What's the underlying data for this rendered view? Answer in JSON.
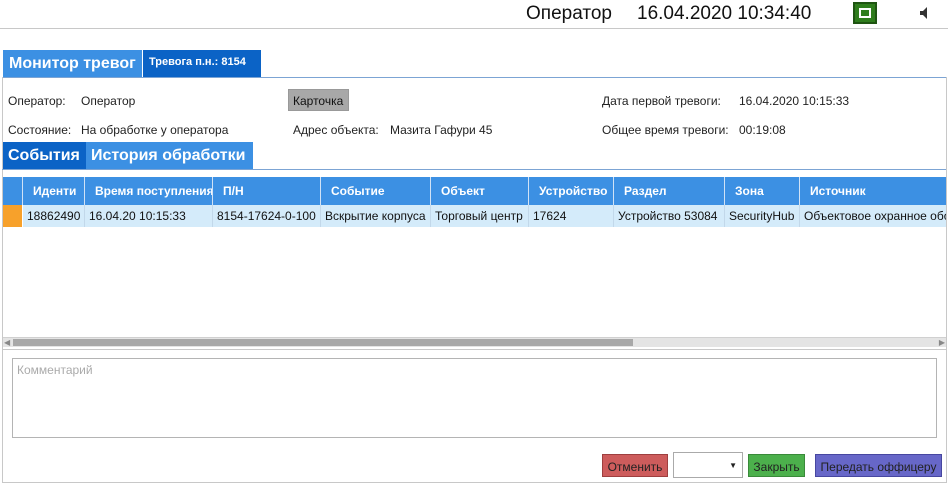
{
  "topbar": {
    "operator_name": "Оператор",
    "datetime": "16.04.2020 10:34:40",
    "network_icon": "network-connected-icon",
    "sound_icon": "speaker-icon",
    "network_color": "#2f7d1d"
  },
  "tabs": {
    "monitor": "Монитор тревог",
    "alarm": "Тревога п.н.: 8154"
  },
  "info": {
    "operator_label": "Оператор:",
    "operator_value": "Оператор",
    "state_label": "Состояние:",
    "state_value": "На обработке у оператора",
    "card_button": "Карточка",
    "address_label": "Адрес объекта:",
    "address_value": "Мазита Гафури 45",
    "first_alarm_label": "Дата первой тревоги:",
    "first_alarm_value": "16.04.2020 10:15:33",
    "total_time_label": "Общее время тревоги:",
    "total_time_value": "00:19:08"
  },
  "subtabs": {
    "events": "События",
    "history": "История обработки"
  },
  "table": {
    "columns": [
      "Иденти",
      "Время поступления",
      "П/Н",
      "Событие",
      "Объект",
      "Устройство",
      "Раздел",
      "Зона",
      "Источник"
    ],
    "rows": [
      [
        "18862490",
        "16.04.20 10:15:33",
        "8154-17624-0-100",
        "Вскрытие корпуса",
        "Торговый центр",
        "17624",
        "Устройство 53084",
        "SecurityHub",
        "Объектовое охранное оборудование"
      ]
    ],
    "row_marker_color": "#f7a12b",
    "header_color": "#3c90e3",
    "row_color": "#d4ebfa"
  },
  "comment": {
    "placeholder": "Комментарий"
  },
  "footer": {
    "cancel": "Отменить",
    "select_value": "",
    "close": "Закрыть",
    "pass_officer": "Передать оффицеру"
  }
}
